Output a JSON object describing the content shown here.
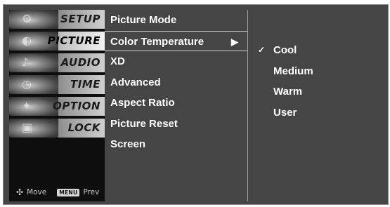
{
  "categories": [
    {
      "label": "SETUP",
      "icon": "setup-icon",
      "glyph": "⚙"
    },
    {
      "label": "PICTURE",
      "icon": "picture-icon",
      "glyph": "◐"
    },
    {
      "label": "AUDIO",
      "icon": "audio-icon",
      "glyph": "♪"
    },
    {
      "label": "TIME",
      "icon": "clock-icon",
      "glyph": "◷"
    },
    {
      "label": "OPTION",
      "icon": "option-icon",
      "glyph": "✦"
    },
    {
      "label": "LOCK",
      "icon": "lock-icon",
      "glyph": "▣"
    }
  ],
  "active_category": "PICTURE",
  "hints": {
    "move_icon": "✣",
    "move_label": "Move",
    "menu_key": "MENU",
    "prev_label": "Prev"
  },
  "options": [
    "Picture Mode",
    "Color Temperature",
    "XD",
    "Advanced",
    "Aspect Ratio",
    "Picture Reset",
    "Screen"
  ],
  "selected_option": "Color Temperature",
  "arrow_glyph": "▶",
  "values": [
    {
      "label": "Cool",
      "checked": true
    },
    {
      "label": "Medium",
      "checked": false
    },
    {
      "label": "Warm",
      "checked": false
    },
    {
      "label": "User",
      "checked": false
    }
  ],
  "check_glyph": "✓",
  "colors": {
    "panel": "#454545",
    "sidebar": "#0e0e0e",
    "text": "#ffffff"
  }
}
